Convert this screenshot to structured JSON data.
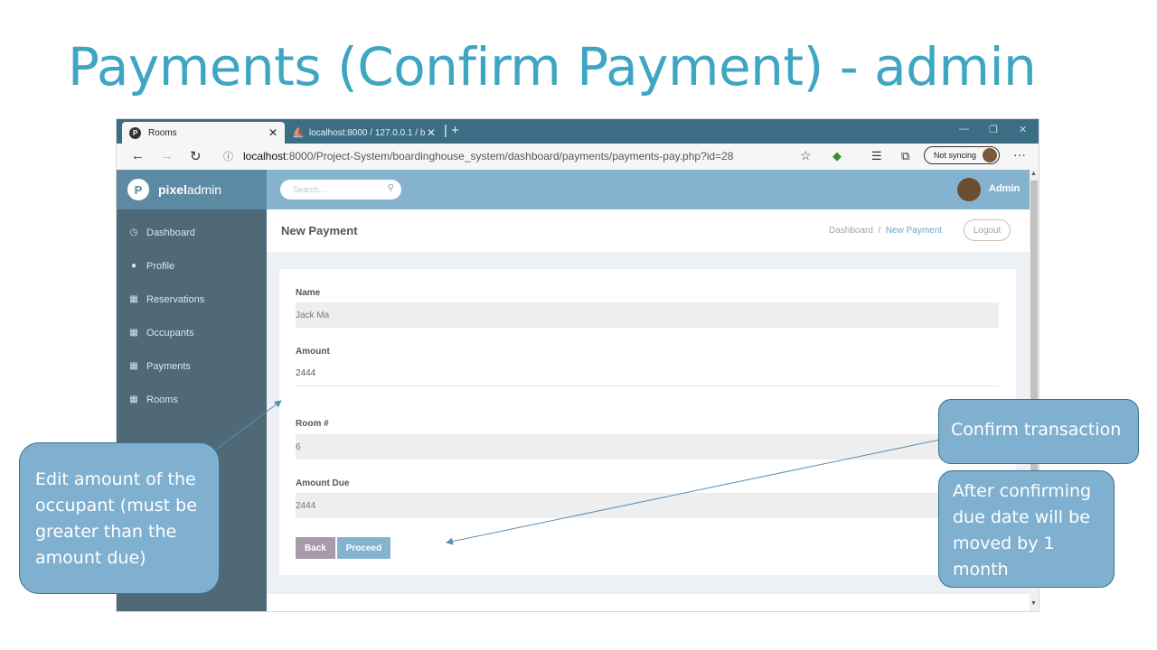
{
  "slide": {
    "title": "Payments (Confirm Payment) - admin"
  },
  "browser": {
    "tabs": [
      {
        "label": "Rooms",
        "active": true,
        "favicon": "P"
      },
      {
        "label": "localhost:8000 / 127.0.0.1 / boar",
        "active": false
      }
    ],
    "url_host": "localhost",
    "url_path": ":8000/Project-System/boardinghouse_system/dashboard/payments/payments-pay.php?id=28",
    "sync_label": "Not syncing"
  },
  "app": {
    "brand_bold": "pixel",
    "brand_light": "admin",
    "brand_logo": "P",
    "search_placeholder": "Search...",
    "user": "Admin",
    "menu": [
      {
        "label": "Dashboard",
        "icon": "clock-icon"
      },
      {
        "label": "Profile",
        "icon": "user-icon"
      },
      {
        "label": "Reservations",
        "icon": "table-icon"
      },
      {
        "label": "Occupants",
        "icon": "table-icon"
      },
      {
        "label": "Payments",
        "icon": "table-icon"
      },
      {
        "label": "Rooms",
        "icon": "table-icon"
      }
    ],
    "page_title": "New Payment",
    "breadcrumb": {
      "home": "Dashboard",
      "sep": "/",
      "current": "New Payment"
    },
    "logout": "Logout",
    "form": {
      "name_label": "Name",
      "name_value": "Jack Ma",
      "amount_label": "Amount",
      "amount_value": "2444",
      "room_label": "Room #",
      "room_value": "6",
      "due_label": "Amount Due",
      "due_value": "2444",
      "back": "Back",
      "proceed": "Proceed"
    }
  },
  "callouts": {
    "edit_amount": "Edit amount of the occupant (must be greater than the amount due)",
    "confirm": "Confirm transaction",
    "after": "After confirming due date will be moved by 1 month"
  },
  "colors": {
    "title": "#3ea6c2",
    "sidebar": "#4f6977",
    "topbar": "#85b3cf",
    "callout": "#7fb0cf"
  }
}
